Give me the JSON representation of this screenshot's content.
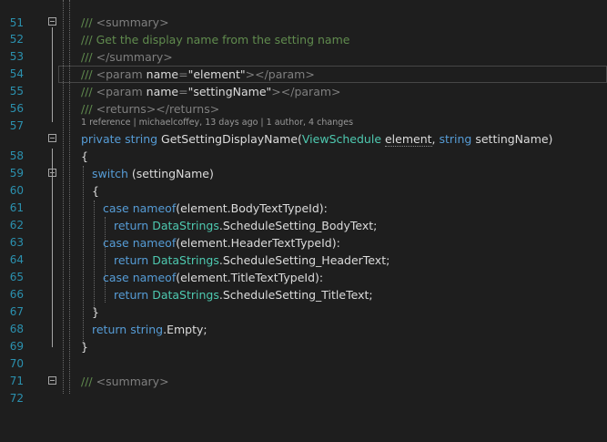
{
  "editor": {
    "line_numbers": [
      "51",
      "52",
      "53",
      "54",
      "55",
      "56",
      "57",
      "58",
      "59",
      "60",
      "61",
      "62",
      "63",
      "64",
      "65",
      "66",
      "67",
      "68",
      "69",
      "70",
      "71",
      "72"
    ],
    "codelens": "1 reference | michaelcoffey, 13 days ago | 1 author, 4 changes",
    "lines": {
      "l52": [
        "/// ",
        "<summary>"
      ],
      "l53": [
        "/// Get the display name from the setting name"
      ],
      "l54": [
        "/// ",
        "</summary>"
      ],
      "l55": [
        "/// ",
        "<param ",
        "name",
        "=",
        "\"element\"",
        "></param>"
      ],
      "l56": [
        "/// ",
        "<param ",
        "name",
        "=",
        "\"settingName\"",
        "></param>"
      ],
      "l57": [
        "/// ",
        "<returns></returns>"
      ],
      "l58": [
        "private ",
        "string ",
        "GetSettingDisplayName(",
        "ViewSchedule ",
        "element",
        ", ",
        "string ",
        "settingName)"
      ],
      "l59": [
        "{"
      ],
      "l60": [
        "switch ",
        "(settingName)"
      ],
      "l61": [
        "{"
      ],
      "l62": [
        "case ",
        "nameof",
        "(element.BodyTextTypeId):"
      ],
      "l63": [
        "return ",
        "DataStrings",
        ".ScheduleSetting_BodyText;"
      ],
      "l64": [
        "case ",
        "nameof",
        "(element.HeaderTextTypeId):"
      ],
      "l65": [
        "return ",
        "DataStrings",
        ".ScheduleSetting_HeaderText;"
      ],
      "l66": [
        "case ",
        "nameof",
        "(element.TitleTextTypeId):"
      ],
      "l67": [
        "return ",
        "DataStrings",
        ".ScheduleSetting_TitleText;"
      ],
      "l68": [
        "}"
      ],
      "l69": [
        "return ",
        "string",
        ".Empty;"
      ],
      "l70": [
        "}"
      ],
      "l72": [
        "/// ",
        "<summary>"
      ]
    }
  }
}
